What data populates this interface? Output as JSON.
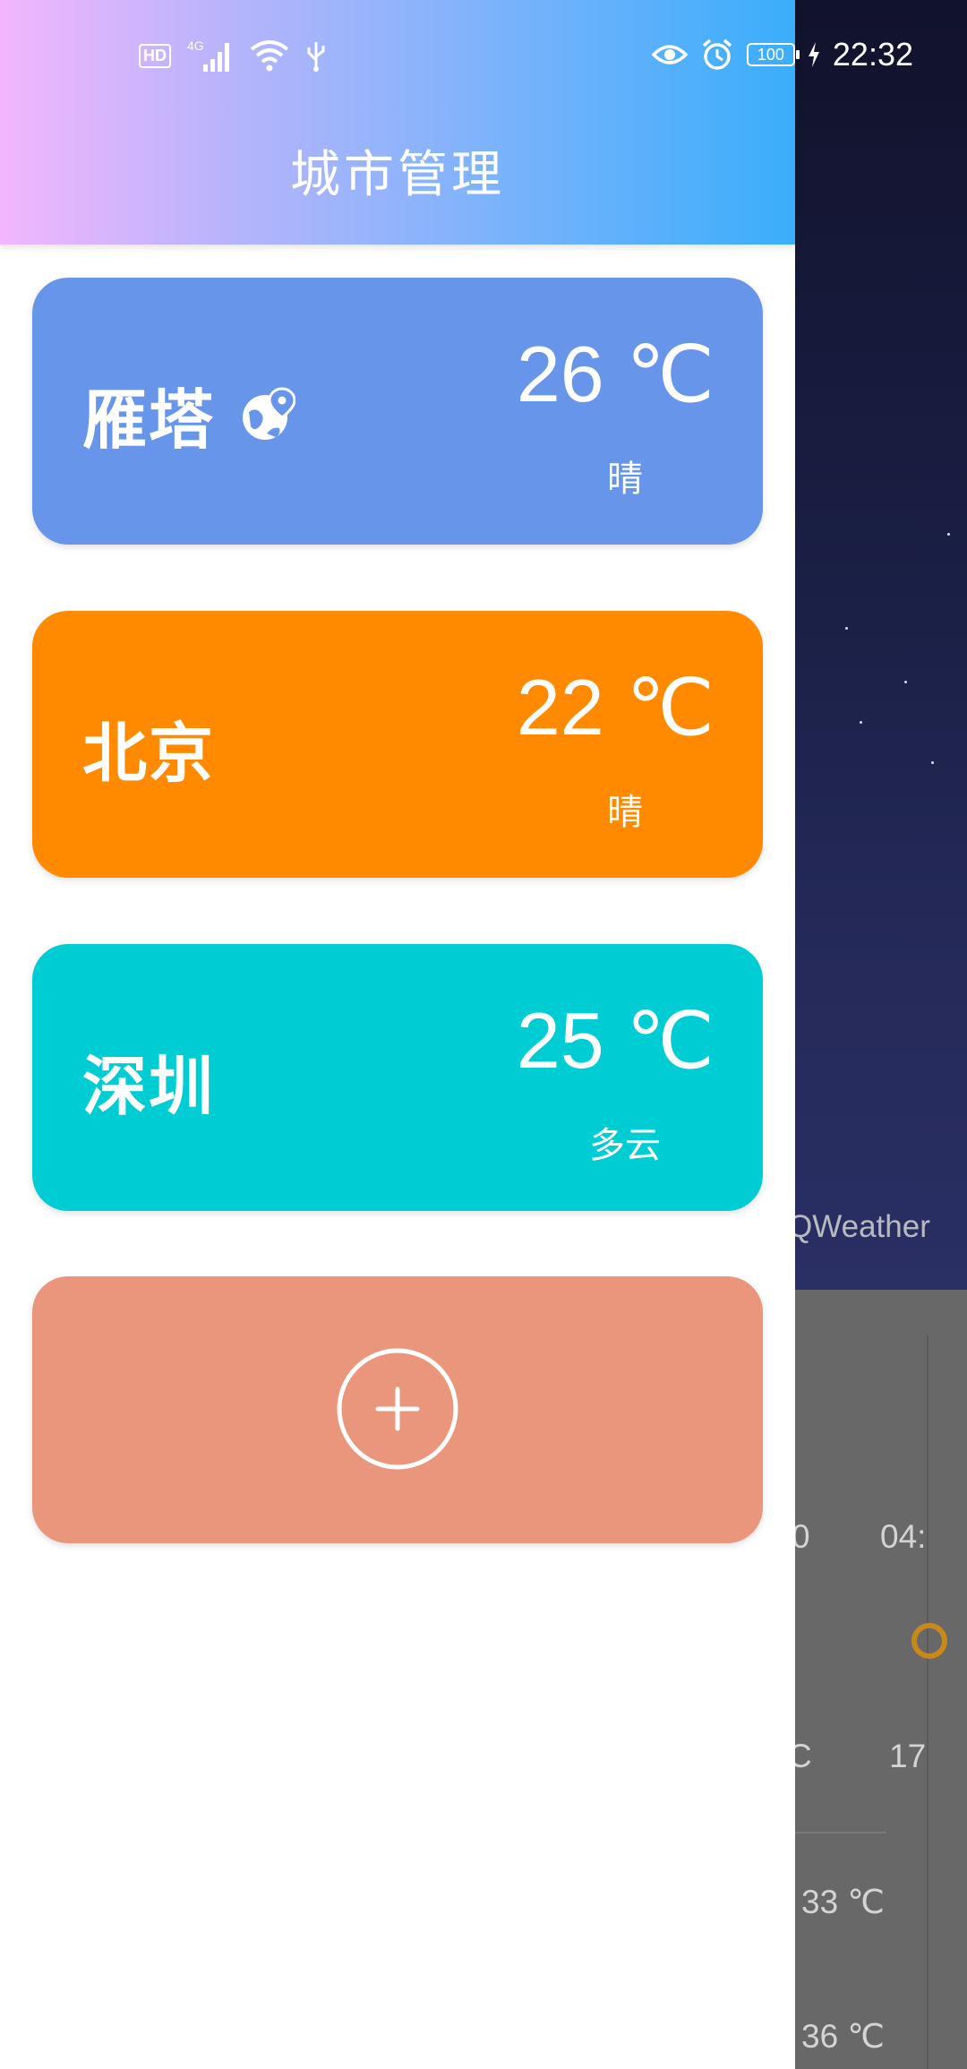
{
  "status_bar": {
    "hd": "HD",
    "network": "4G",
    "battery": "100",
    "time": "22:32"
  },
  "drawer": {
    "title": "城市管理",
    "cities": [
      {
        "name": "雁塔",
        "temp": "26 ℃",
        "weather": "晴",
        "color": "#6695ea",
        "located": true
      },
      {
        "name": "北京",
        "temp": "22 ℃",
        "weather": "晴",
        "color": "#ff8a00",
        "located": false
      },
      {
        "name": "深圳",
        "temp": "25 ℃",
        "weather": "多云",
        "color": "#00ccd3",
        "located": false
      }
    ],
    "add_card_color": "#ea967c"
  },
  "background": {
    "watermark": "QWeather",
    "hourly_times": [
      "0",
      "04:"
    ],
    "hourly_temps": [
      "C",
      "17"
    ],
    "daily_temps": [
      "33 ℃",
      "36 ℃"
    ]
  }
}
